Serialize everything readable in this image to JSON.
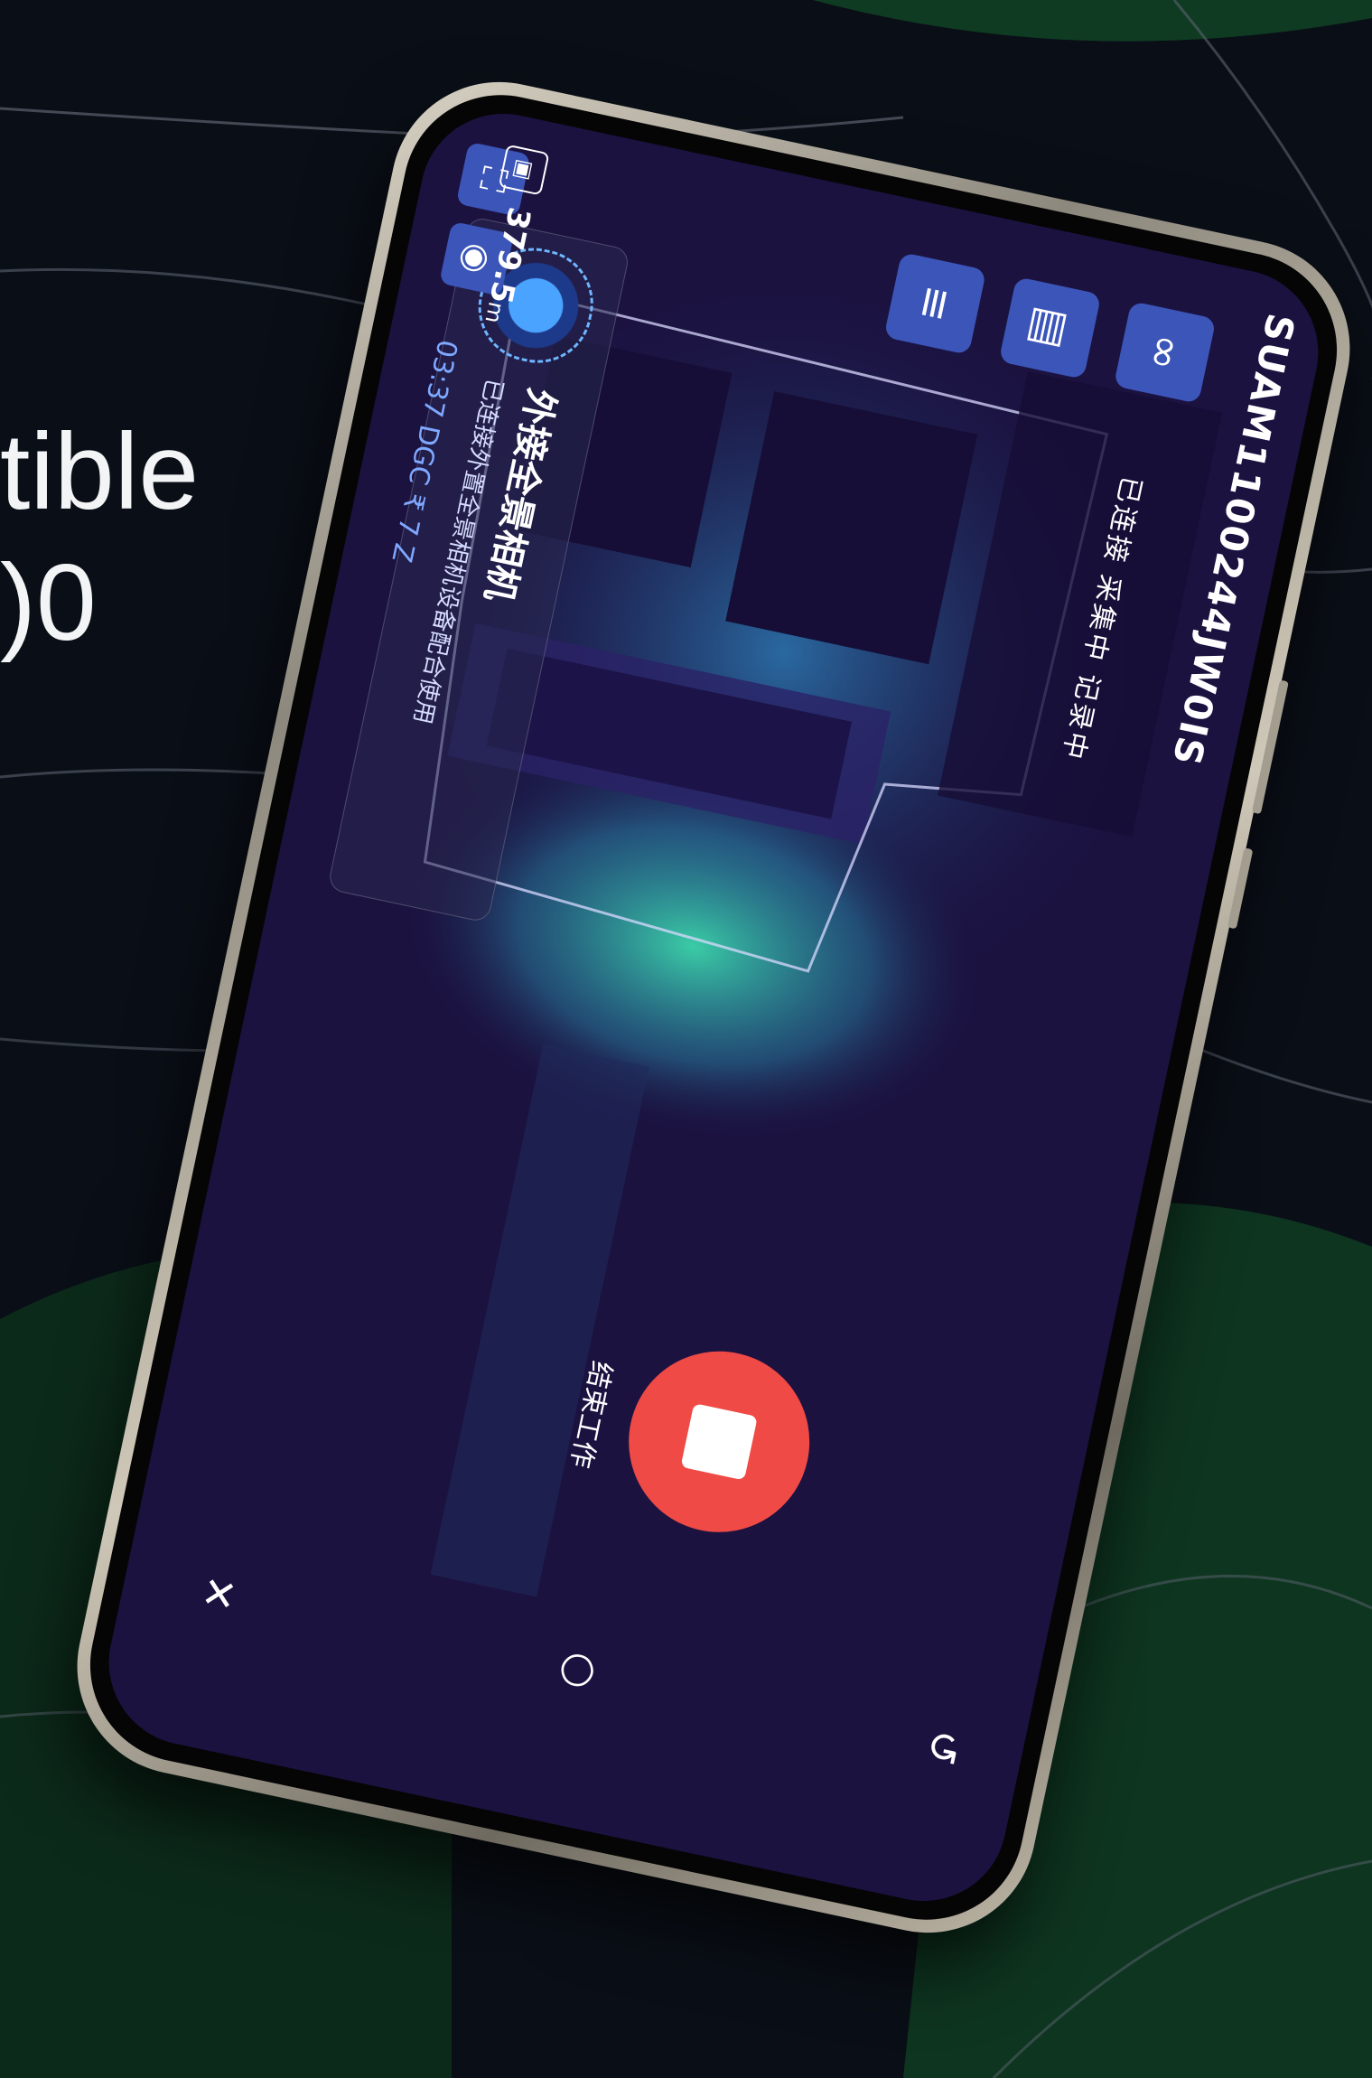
{
  "headline": {
    "line1": "tible",
    "line2": ")0"
  },
  "phone_ui": {
    "device_serial": "SUAM1100244JW0IS",
    "status_text": "已连接 采集中 记录中",
    "info_card": {
      "title": "外接全景相机",
      "subtitle": "已连接外置全景相机设备配合使用"
    },
    "readout_value": "379.5",
    "readout_unit": "m",
    "readout_sub": "03:37 DGC ₹ 7 Z",
    "stop_label": "结束工作",
    "colors": {
      "accent": "#3b55b8",
      "record": "#ef4a45",
      "screen_bg": "#1b1240",
      "map_glow": "#3ee0b0"
    },
    "icons": {
      "camera": "camera-icon",
      "scan": "scan-icon",
      "link": "link-icon",
      "info": "info-card-icon",
      "list": "list-icon",
      "file": "file-icon",
      "stop": "stop-square-icon",
      "back": "back-icon",
      "home": "home-circle-icon",
      "close": "close-icon"
    }
  }
}
